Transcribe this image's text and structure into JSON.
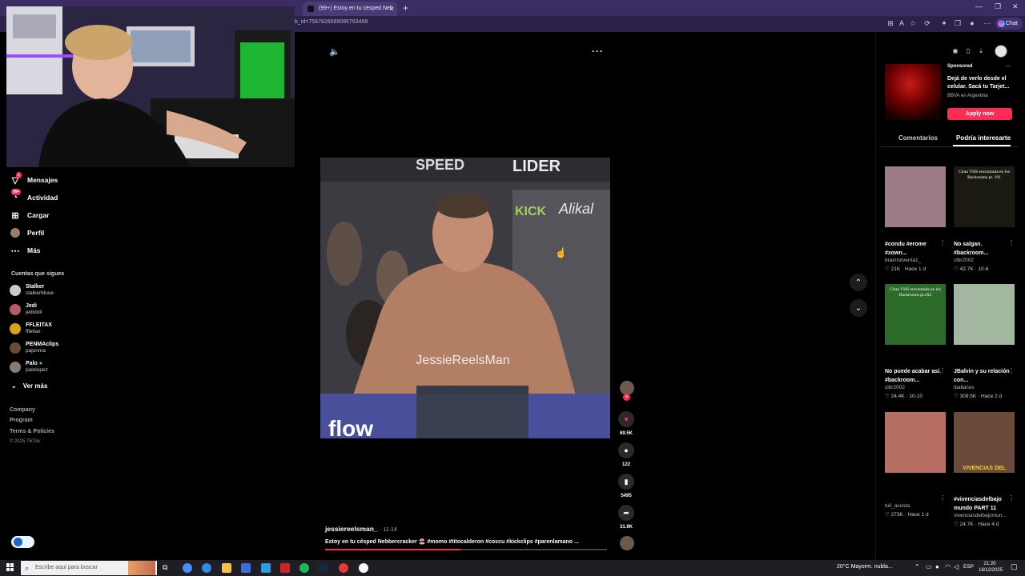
{
  "browser": {
    "active_tab_title": "(99+) Estoy en tu césped Neb",
    "url": "b_id=7567826689095763468",
    "chat_button_label": "Chat"
  },
  "sidebar": {
    "items": [
      {
        "icon": "paper-plane-icon",
        "label": "Mensajes"
      },
      {
        "icon": "bell-icon",
        "label": "Actividad",
        "badge": "99+"
      },
      {
        "icon": "upload-icon",
        "label": "Cargar"
      },
      {
        "icon": "avatar-icon",
        "label": "Perfil"
      },
      {
        "icon": "ellipsis-icon",
        "label": "Más"
      }
    ],
    "following_title": "Cuentas que sigues",
    "following": [
      {
        "name": "Stalker",
        "user": "stalkerbluue",
        "color": "#c9c9c9"
      },
      {
        "name": "Jedi",
        "user": "jedidoll",
        "color": "#b35b6b"
      },
      {
        "name": "FFLEITAX",
        "user": "ffleitax",
        "color": "#d9a21a"
      },
      {
        "name": "PENMAclips",
        "user": "pajonma",
        "color": "#6b4a3a"
      },
      {
        "name": "Palo",
        "user": "palolopez",
        "color": "#8a7b6a"
      }
    ],
    "see_more": "Ver más",
    "footer_links": [
      "Company",
      "Program",
      "Terms & Policies"
    ],
    "copyright": "© 2025 TikTok"
  },
  "video": {
    "overlay_texts": [
      "SPEED",
      "LIDER",
      "KICK",
      "Alikal",
      "JessieReelsMan",
      "flow"
    ],
    "author": "jessiereelsman_",
    "date": "· 11-14",
    "caption": "Estoy en tu césped Nebbercracker 🏖️ #momo #titocalderon #coscu #kickclips #parenlamano ...",
    "progress": 0.48
  },
  "actions": {
    "likes": "69.5K",
    "comments": "122",
    "saves": "5495",
    "shares": "31.9K"
  },
  "right_panel": {
    "ad": {
      "sponsored": "Sponsored",
      "title": "Dejá de verlo desde el celular. Sacá tu Tarjet...",
      "advertiser": "BBVA en Argentina",
      "cta": "Apply now"
    },
    "tabs": [
      "Comentarios",
      "Podría interesarte"
    ],
    "cards": [
      {
        "title": "#condu #erome #xown...",
        "user": "brainrotventa1_",
        "likes": "21K",
        "time": "Hace 1 d",
        "thumb_text": "",
        "bg": "#9c7d86"
      },
      {
        "title": "No salgan. #backroom...",
        "user": "clbr2002",
        "likes": "42.7K",
        "time": "10-6",
        "thumb_text": "Cinta VHS encontrada en los Backrooms pt. 191",
        "bg": "#1b1a12"
      },
      {
        "title": "No puede acabar así. #backroom...",
        "user": "clbr2002",
        "likes": "24.4K",
        "time": "10-10",
        "thumb_text": "Cinta VHS encontrada en los Backrooms pt.202",
        "bg": "#2d6b2a"
      },
      {
        "title": "JBalvin y su relación con...",
        "user": "iballanos",
        "likes": "309.5K",
        "time": "Hace 2 d",
        "thumb_text": "",
        "bg": "#a3b6a0"
      },
      {
        "title": "",
        "user": "tuli_acosta",
        "likes": "273K",
        "time": "Hace 1 d",
        "thumb_text": "",
        "bg": "#b86f63"
      },
      {
        "title": "#vivenciasdelbajo mundo PART 11",
        "user": "vivenciasdelbajomun...",
        "likes": "24.7K",
        "time": "Hace 4 d",
        "thumb_text": "VIVENCIAS DEL",
        "bg": "#6a4a3a"
      }
    ]
  },
  "taskbar": {
    "search_placeholder": "Escribe aquí para buscar",
    "weather": "20°C  Mayorm. nubla...",
    "lang": "ESP",
    "time": "21:20",
    "date": "18/12/2025"
  }
}
